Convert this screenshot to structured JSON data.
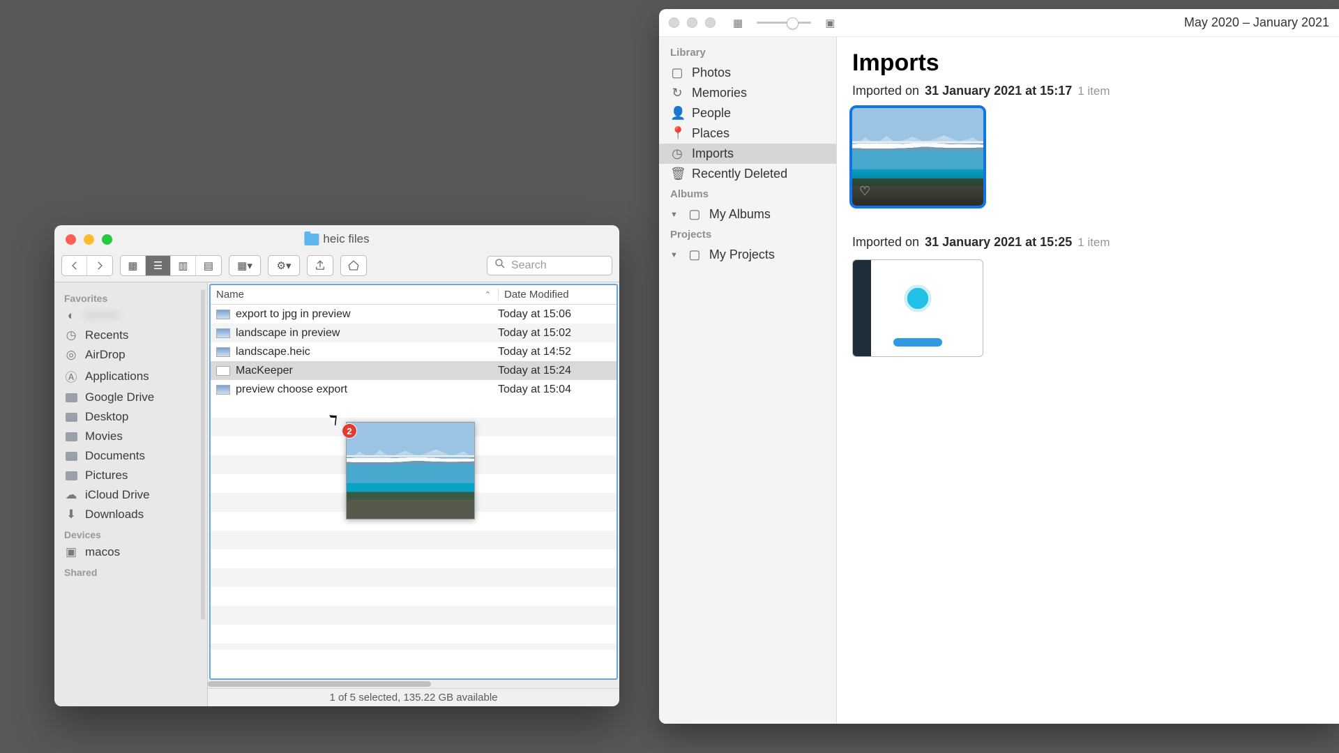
{
  "finder": {
    "title": "heic files",
    "favorites_label": "Favorites",
    "devices_label": "Devices",
    "shared_label": "Shared",
    "blurred_item": "••••••••",
    "sidebar": [
      {
        "label": "Recents",
        "icon": "clock"
      },
      {
        "label": "AirDrop",
        "icon": "radio"
      },
      {
        "label": "Applications",
        "icon": "apps"
      },
      {
        "label": "Google Drive",
        "icon": "folder"
      },
      {
        "label": "Desktop",
        "icon": "folder"
      },
      {
        "label": "Movies",
        "icon": "folder"
      },
      {
        "label": "Documents",
        "icon": "folder"
      },
      {
        "label": "Pictures",
        "icon": "folder"
      },
      {
        "label": "iCloud Drive",
        "icon": "cloud"
      },
      {
        "label": "Downloads",
        "icon": "download"
      }
    ],
    "device": "macos",
    "search_placeholder": "Search",
    "col_name": "Name",
    "col_date": "Date Modified",
    "files": [
      {
        "name": "export to jpg in preview",
        "date": "Today at 15:06"
      },
      {
        "name": "landscape in preview",
        "date": "Today at 15:02"
      },
      {
        "name": "landscape.heic",
        "date": "Today at 14:52"
      },
      {
        "name": "MacKeeper",
        "date": "Today at 15:24"
      },
      {
        "name": "preview choose export",
        "date": "Today at 15:04"
      }
    ],
    "selected_index": 3,
    "drag_badge": "2",
    "status": "1 of 5 selected, 135.22 GB available"
  },
  "photos": {
    "date_range": "May 2020 – January 2021",
    "library_label": "Library",
    "albums_label": "Albums",
    "projects_label": "Projects",
    "nav": [
      {
        "label": "Photos",
        "icon": "photos"
      },
      {
        "label": "Memories",
        "icon": "memories"
      },
      {
        "label": "People",
        "icon": "person"
      },
      {
        "label": "Places",
        "icon": "pin"
      },
      {
        "label": "Imports",
        "icon": "imports"
      },
      {
        "label": "Recently Deleted",
        "icon": "trash"
      }
    ],
    "my_albums": "My Albums",
    "my_projects": "My Projects",
    "title": "Imports",
    "sections": [
      {
        "prefix": "Imported on",
        "date": "31 January 2021 at 15:17",
        "count": "1 item",
        "kind": "landscape",
        "selected": true
      },
      {
        "prefix": "Imported on",
        "date": "31 January 2021 at 15:25",
        "count": "1 item",
        "kind": "screenshot",
        "selected": false
      }
    ]
  }
}
